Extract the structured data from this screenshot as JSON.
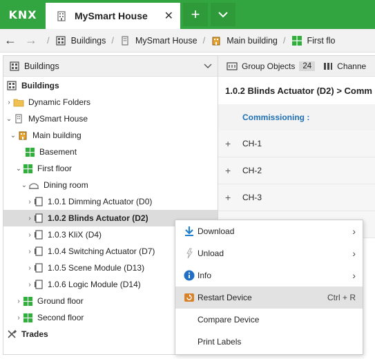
{
  "app": {
    "logo": "KNX"
  },
  "tab": {
    "title": "MySmart House",
    "close": "✕"
  },
  "titlebar": {
    "add": "+",
    "dropdown": "⌄"
  },
  "nav": {
    "back": "←",
    "forward": "→",
    "separator": "/",
    "breadcrumbs": [
      "Buildings",
      "MySmart House",
      "Main building",
      "First flo"
    ]
  },
  "left_panel": {
    "header": "Buildings",
    "tree": [
      {
        "label": "Buildings",
        "bold": true
      },
      {
        "label": "Dynamic Folders"
      },
      {
        "label": "MySmart House"
      },
      {
        "label": "Main building"
      },
      {
        "label": "Basement"
      },
      {
        "label": "First floor"
      },
      {
        "label": "Dining room"
      },
      {
        "label": "1.0.1 Dimming Actuator (D0)"
      },
      {
        "label": "1.0.2 Blinds Actuator (D2)",
        "bold": true,
        "selected": true
      },
      {
        "label": "1.0.3 KliX (D4)"
      },
      {
        "label": "1.0.4 Switching Actuator (D7)"
      },
      {
        "label": "1.0.5 Scene Module (D13)"
      },
      {
        "label": "1.0.6 Logic Module (D14)"
      },
      {
        "label": "Ground floor"
      },
      {
        "label": "Second floor"
      },
      {
        "label": "Trades",
        "bold": true
      }
    ]
  },
  "right_panel": {
    "tabs": [
      {
        "label": "Group Objects",
        "badge": "24"
      },
      {
        "label": "Channe"
      }
    ],
    "device_title": "1.0.2 Blinds Actuator (D2) > Comm",
    "commissioning_label": "Commissioning :",
    "channels": [
      "CH-1",
      "CH-2",
      "CH-3"
    ]
  },
  "context_menu": {
    "items": [
      {
        "label": "Download",
        "submenu": "›"
      },
      {
        "label": "Unload",
        "submenu": "›"
      },
      {
        "label": "Info",
        "submenu": "›"
      },
      {
        "label": "Restart Device",
        "shortcut": "Ctrl + R"
      },
      {
        "label": "Compare Device"
      },
      {
        "label": "Print Labels"
      }
    ]
  },
  "colors": {
    "brand_green": "#33a540",
    "accent_blue": "#1e6fb5"
  }
}
